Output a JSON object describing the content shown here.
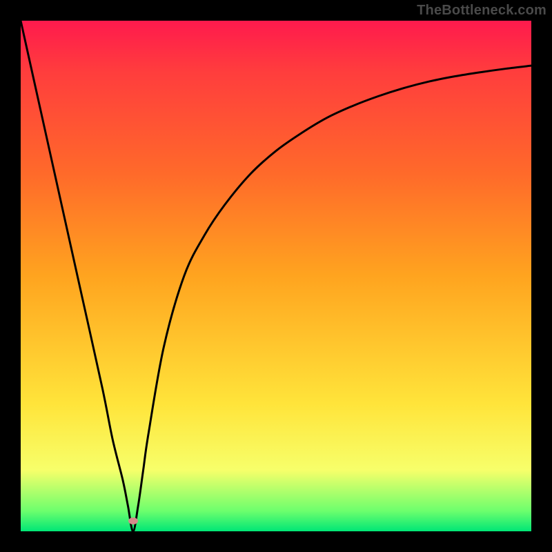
{
  "watermark": "TheBottleneck.com",
  "chart_data": {
    "type": "line",
    "title": "",
    "xlabel": "",
    "ylabel": "",
    "xlim": [
      0,
      100
    ],
    "ylim": [
      0,
      100
    ],
    "grid": false,
    "legend": false,
    "series": [
      {
        "name": "curve",
        "x": [
          0,
          4,
          8,
          12,
          16,
          18,
          20,
          21,
          22,
          23,
          24,
          25,
          28,
          32,
          36,
          40,
          45,
          50,
          55,
          60,
          65,
          70,
          75,
          80,
          85,
          90,
          95,
          100
        ],
        "y": [
          100,
          82,
          64,
          46,
          28,
          18,
          10,
          5,
          0,
          5,
          12,
          19,
          36,
          50,
          58,
          64,
          70,
          74.5,
          78,
          81,
          83.3,
          85.2,
          86.8,
          88.1,
          89.1,
          89.9,
          90.6,
          91.2
        ]
      }
    ],
    "min_marker": {
      "x": 22,
      "y": 2,
      "color": "#d38a8a"
    },
    "colors": {
      "curve": "#000000",
      "background_top": "#ff1a4d",
      "background_bottom": "#00e676",
      "frame": "#000000"
    }
  }
}
